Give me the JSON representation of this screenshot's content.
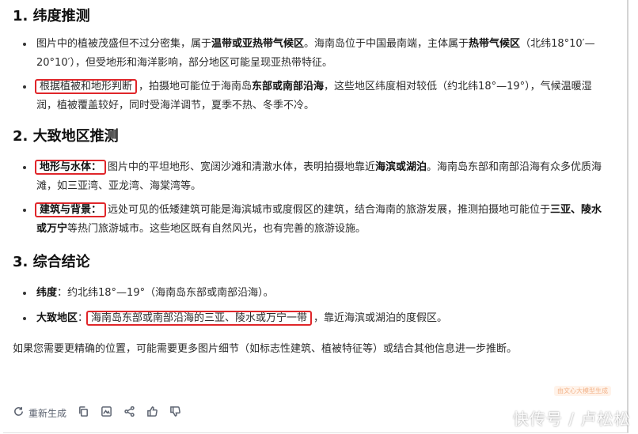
{
  "sections": [
    {
      "heading": "1. 纬度推测",
      "items": [
        {
          "parts": [
            {
              "t": "图片中的植被茂盛但不过分密集，属于"
            },
            {
              "t": "温带或亚热带气候区",
              "b": true
            },
            {
              "t": "。海南岛位于中国最南端，主体属于"
            },
            {
              "t": "热带气候区",
              "b": true
            },
            {
              "t": "（北纬18°10′—20°10′），但受地形和海洋影响，部分地区可能呈现亚热带特征。"
            }
          ]
        },
        {
          "parts": [
            {
              "t": "根据植被和地形判断",
              "box": true
            },
            {
              "t": "，拍摄地可能位于海南岛"
            },
            {
              "t": "东部或南部沿海",
              "b": true
            },
            {
              "t": "，这些地区纬度相对较低（约北纬18°—19°），气候温暖湿润，植被覆盖较好，同时受海洋调节，夏季不热、冬季不冷。"
            }
          ]
        }
      ]
    },
    {
      "heading": "2. 大致地区推测",
      "items": [
        {
          "parts": [
            {
              "t": "地形与水体：",
              "b": true,
              "box": true
            },
            {
              "t": "图片中的平坦地形、宽阔沙滩和清澈水体，表明拍摄地靠近"
            },
            {
              "t": "海滨或湖泊",
              "b": true
            },
            {
              "t": "。海南岛东部和南部沿海有众多优质海滩，如三亚湾、亚龙湾、海棠湾等。"
            }
          ]
        },
        {
          "parts": [
            {
              "t": "建筑与背景：",
              "b": true,
              "box": true
            },
            {
              "t": "远处可见的低矮建筑可能是海滨城市或度假区的建筑，结合海南的旅游发展，推测拍摄地可能位于"
            },
            {
              "t": "三亚、陵水或万宁",
              "b": true
            },
            {
              "t": "等热门旅游城市。这些地区既有自然风光，也有完善的旅游设施。"
            }
          ]
        }
      ]
    },
    {
      "heading": "3. 综合结论",
      "items": [
        {
          "parts": [
            {
              "t": "纬度",
              "b": true
            },
            {
              "t": "：约北纬18°—19°（海南岛东部或南部沿海）。"
            }
          ]
        },
        {
          "parts": [
            {
              "t": "大致地区",
              "b": true
            },
            {
              "t": "："
            },
            {
              "t": "海南岛东部或南部沿海的三亚、陵水或万宁一带",
              "box": true
            },
            {
              "t": "，靠近海滨或湖泊的度假区。"
            }
          ]
        }
      ]
    }
  ],
  "closing": "如果您需要更精确的位置，可能需要更多图片细节（如标志性建筑、植被特征等）或结合其他信息进一步推断。",
  "ai_badge": "由文心大模型生成",
  "toolbar": {
    "regenerate_label": "重新生成",
    "icons": [
      "refresh-icon",
      "copy-icon",
      "image-icon",
      "share-icon",
      "thumbs-up-icon",
      "thumbs-down-icon"
    ]
  },
  "watermark": "快传号 / 卢松松",
  "colors": {
    "highlight_box": "#e0262a",
    "text": "#2b2b2b",
    "toolbar": "#5c6370"
  }
}
